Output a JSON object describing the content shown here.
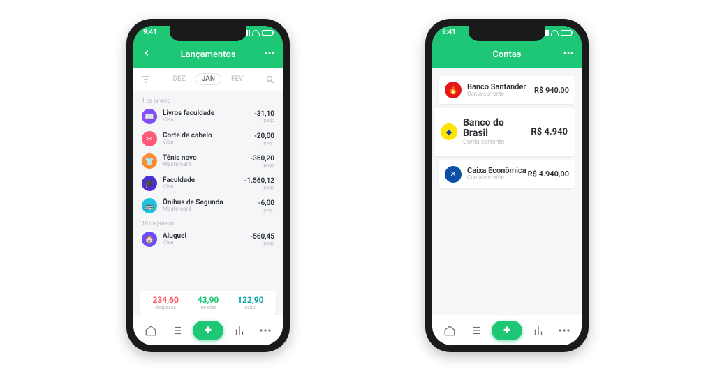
{
  "statusTime": "9:41",
  "left": {
    "title": "Lançamentos",
    "months": {
      "prev": "DEZ",
      "cur": "JAN",
      "next": "FEV"
    },
    "sections": [
      {
        "label": "1 de janeiro",
        "items": [
          {
            "name": "Livros faculdade",
            "sub": "Visa",
            "amount": "-31,10",
            "status": "pago",
            "color": "#7f50ff",
            "icon": "book"
          },
          {
            "name": "Corte de cabelo",
            "sub": "Visa",
            "amount": "-20,00",
            "status": "pago",
            "color": "#ff5a7a",
            "icon": "scissors"
          },
          {
            "name": "Tênis novo",
            "sub": "Mastercard",
            "amount": "-360,20",
            "status": "pago",
            "color": "#ff8a2b",
            "icon": "shirt"
          },
          {
            "name": "Faculdade",
            "sub": "Visa",
            "amount": "-1.560,12",
            "status": "pago",
            "color": "#4d2fcf",
            "icon": "cap"
          },
          {
            "name": "Ônibus de Segunda",
            "sub": "Mastercard",
            "amount": "-6,00",
            "status": "pago",
            "color": "#1fc2e0",
            "icon": "bus"
          }
        ]
      },
      {
        "label": "10 de janeiro",
        "items": [
          {
            "name": "Aluguel",
            "sub": "Visa",
            "amount": "-560,45",
            "status": "pago",
            "color": "#6b4dff",
            "icon": "home"
          }
        ]
      }
    ],
    "summary": {
      "expense": {
        "value": "234,60",
        "label": "despesas"
      },
      "income": {
        "value": "43,90",
        "label": "receitas"
      },
      "balance": {
        "value": "122,90",
        "label": "saldo"
      }
    }
  },
  "right": {
    "title": "Contas",
    "accounts": [
      {
        "name": "Banco Santander",
        "sub": "Conta corrente",
        "amount": "R$ 940,00",
        "color": "#e31818",
        "big": false
      },
      {
        "name": "Banco do Brasil",
        "sub": "Conta corrente",
        "amount": "R$ 4.940",
        "color": "#ffe400",
        "big": true
      },
      {
        "name": "Caixa Econômica",
        "sub": "Conta corrente",
        "amount": "R$ 4.940,00",
        "color": "#0a4fa3",
        "big": false
      }
    ]
  }
}
